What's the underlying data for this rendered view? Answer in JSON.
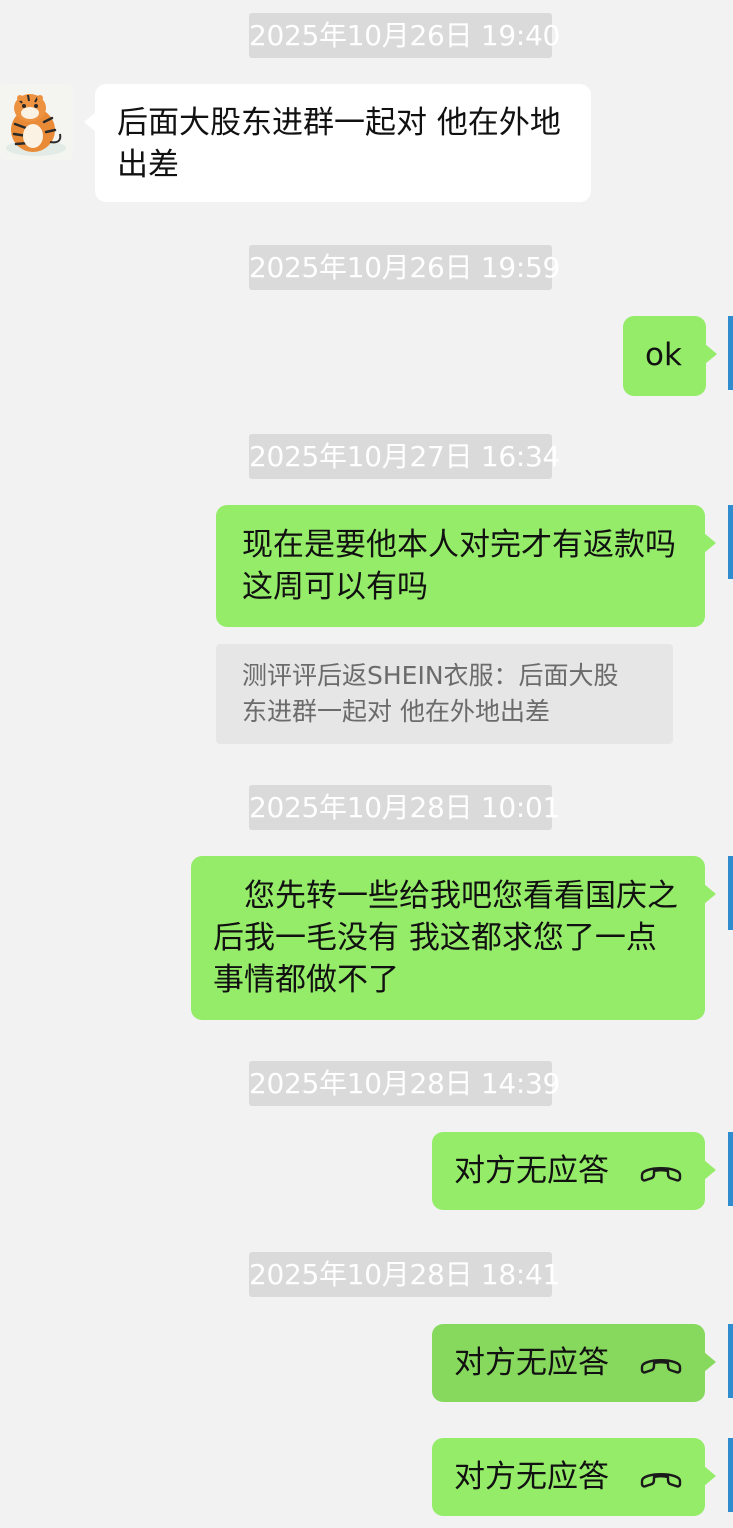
{
  "timestamps": [
    "2025年10月26日 19:40",
    "2025年10月26日 19:59",
    "2025年10月27日 16:34",
    "2025年10月28日 10:01",
    "2025年10月28日 14:39",
    "2025年10月28日 18:41"
  ],
  "messages": {
    "m1": "后面大股东进群一起对 他在外地\n出差",
    "m2": "ok",
    "m3": "现在是要他本人对完才有返款吗\n这周可以有吗",
    "quote": "测评评后返SHEIN衣服：后面大股\n东进群一起对 他在外地出差",
    "m4": "　您先转一些给我吧您看看国庆之\n后我一毛没有 我这都求您了一点\n事情都做不了",
    "call1": "对方无应答",
    "call2": "对方无应答",
    "call3": "对方无应答"
  },
  "colors": {
    "background": "#f2f2f2",
    "outgoing_bubble": "#95ec69",
    "incoming_bubble": "#ffffff",
    "timestamp_bg": "#dadada",
    "quote_bg": "#e6e6e6",
    "edge_accent": "#2f8ccf"
  },
  "icons": {
    "avatar": "tiger-avatar",
    "call": "phone-hangup-icon"
  }
}
